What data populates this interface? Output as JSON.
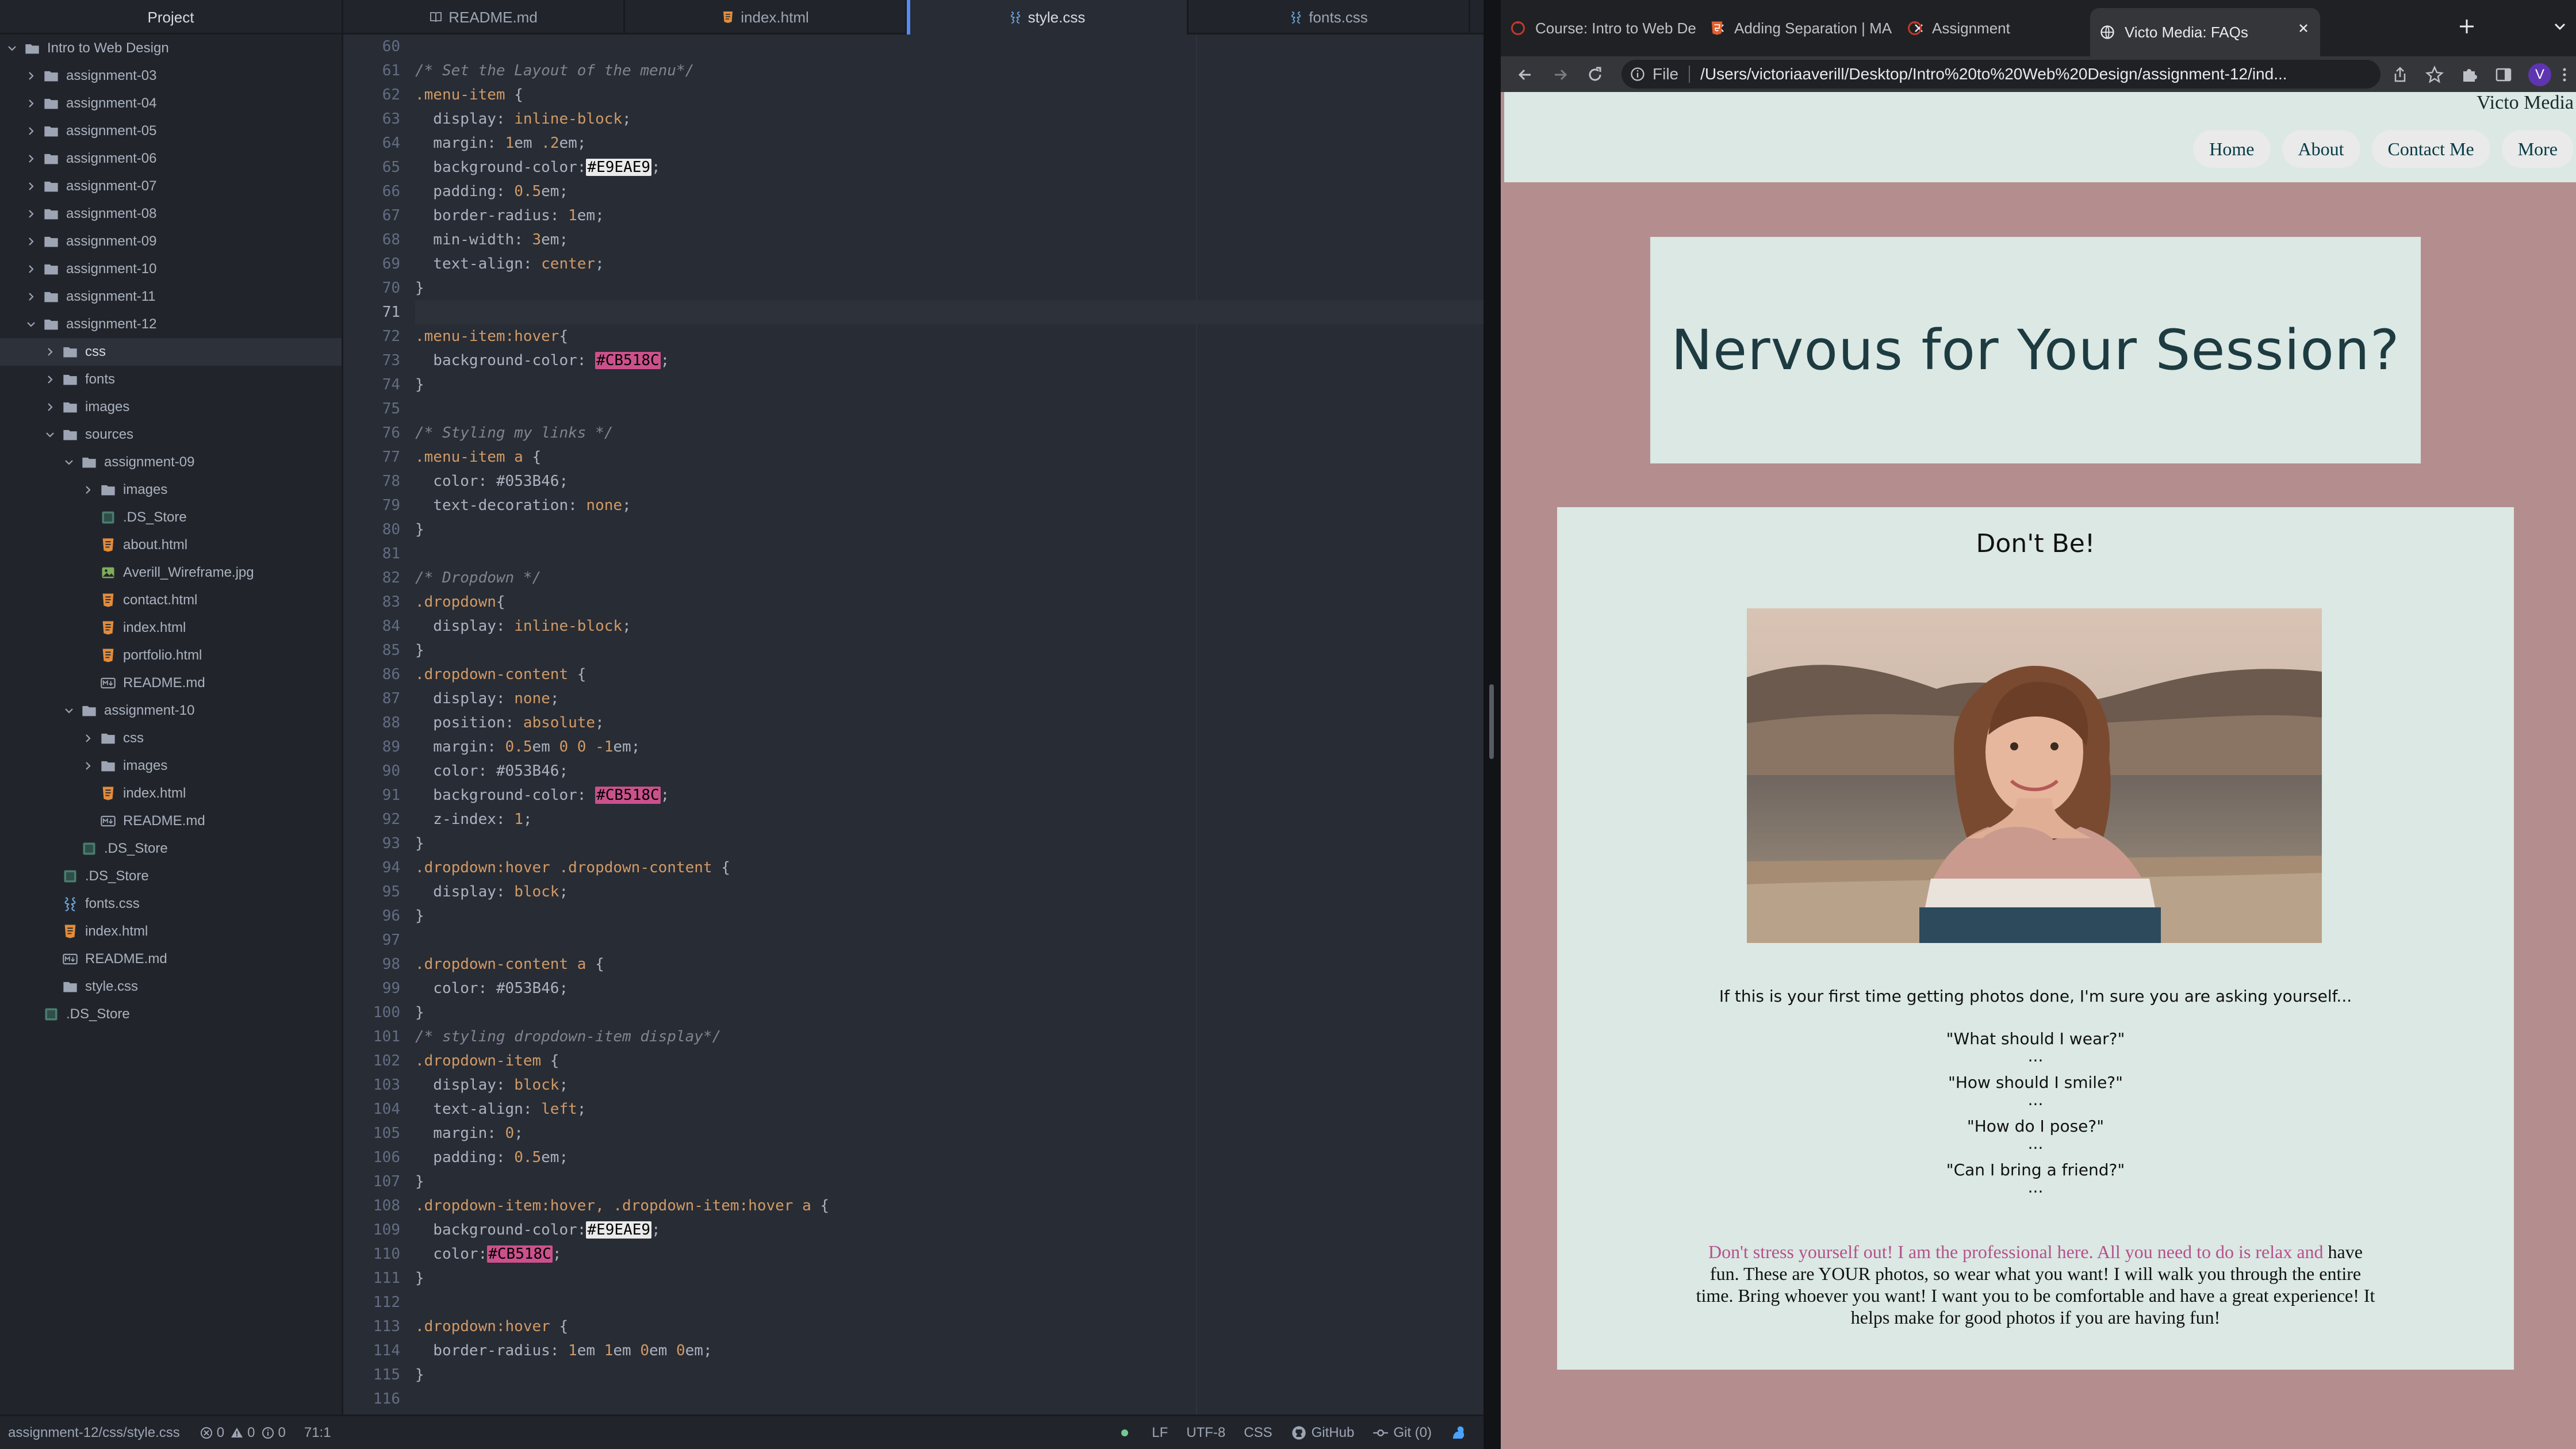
{
  "project": {
    "title": "Project",
    "tree": [
      {
        "label": "Intro to Web Design",
        "type": "root",
        "depth": 0,
        "open": true
      },
      {
        "label": "assignment-03",
        "type": "folder",
        "depth": 1,
        "open": false
      },
      {
        "label": "assignment-04",
        "type": "folder",
        "depth": 1,
        "open": false
      },
      {
        "label": "assignment-05",
        "type": "folder",
        "depth": 1,
        "open": false
      },
      {
        "label": "assignment-06",
        "type": "folder",
        "depth": 1,
        "open": false
      },
      {
        "label": "assignment-07",
        "type": "folder",
        "depth": 1,
        "open": false
      },
      {
        "label": "assignment-08",
        "type": "folder",
        "depth": 1,
        "open": false
      },
      {
        "label": "assignment-09",
        "type": "folder",
        "depth": 1,
        "open": false
      },
      {
        "label": "assignment-10",
        "type": "folder",
        "depth": 1,
        "open": false
      },
      {
        "label": "assignment-11",
        "type": "folder",
        "depth": 1,
        "open": false
      },
      {
        "label": "assignment-12",
        "type": "folder",
        "depth": 1,
        "open": true
      },
      {
        "label": "css",
        "type": "folder",
        "depth": 2,
        "open": false,
        "selected": true
      },
      {
        "label": "fonts",
        "type": "folder",
        "depth": 2,
        "open": false
      },
      {
        "label": "images",
        "type": "folder",
        "depth": 2,
        "open": false
      },
      {
        "label": "sources",
        "type": "folder",
        "depth": 2,
        "open": true
      },
      {
        "label": "assignment-09",
        "type": "folder",
        "depth": 3,
        "open": true
      },
      {
        "label": "images",
        "type": "folder",
        "depth": 4,
        "open": false
      },
      {
        "label": ".DS_Store",
        "type": "ds",
        "depth": 4
      },
      {
        "label": "about.html",
        "type": "html",
        "depth": 4
      },
      {
        "label": "Averill_Wireframe.jpg",
        "type": "image",
        "depth": 4
      },
      {
        "label": "contact.html",
        "type": "html",
        "depth": 4
      },
      {
        "label": "index.html",
        "type": "html",
        "depth": 4
      },
      {
        "label": "portfolio.html",
        "type": "html",
        "depth": 4
      },
      {
        "label": "README.md",
        "type": "md",
        "depth": 4
      },
      {
        "label": "assignment-10",
        "type": "folder",
        "depth": 3,
        "open": true
      },
      {
        "label": "css",
        "type": "folder",
        "depth": 4,
        "open": false
      },
      {
        "label": "images",
        "type": "folder",
        "depth": 4,
        "open": false
      },
      {
        "label": "index.html",
        "type": "html",
        "depth": 4
      },
      {
        "label": "README.md",
        "type": "md",
        "depth": 4
      },
      {
        "label": ".DS_Store",
        "type": "ds",
        "depth": 3
      },
      {
        "label": ".DS_Store",
        "type": "ds",
        "depth": 2
      },
      {
        "label": "fonts.css",
        "type": "css",
        "depth": 2
      },
      {
        "label": "index.html",
        "type": "html",
        "depth": 2
      },
      {
        "label": "README.md",
        "type": "md",
        "depth": 2
      },
      {
        "label": "style.css",
        "type": "cssfolder",
        "depth": 2
      },
      {
        "label": ".DS_Store",
        "type": "ds",
        "depth": 1
      }
    ]
  },
  "editor": {
    "tabs": [
      {
        "label": "README.md",
        "icon": "book-icon",
        "active": false
      },
      {
        "label": "index.html",
        "icon": "html-file-icon",
        "active": false
      },
      {
        "label": "style.css",
        "icon": "css-file-icon",
        "active": true
      },
      {
        "label": "fonts.css",
        "icon": "css-file-icon",
        "active": false
      }
    ],
    "first_line": 60,
    "cursor_line": 71,
    "lines": [
      [],
      [
        [
          "com",
          "/* Set the Layout of the menu*/"
        ]
      ],
      [
        [
          "sel",
          ".menu-item"
        ],
        [
          "plain",
          " {"
        ]
      ],
      [
        [
          "plain",
          "  display: "
        ],
        [
          "val",
          "inline-block"
        ],
        [
          "plain",
          ";"
        ]
      ],
      [
        [
          "plain",
          "  margin: "
        ],
        [
          "num",
          "1"
        ],
        [
          "unit",
          "em "
        ],
        [
          "num",
          ".2"
        ],
        [
          "unit",
          "em"
        ],
        [
          "plain",
          ";"
        ]
      ],
      [
        [
          "plain",
          "  background-color:"
        ],
        [
          "swl",
          "#E9EAE9"
        ],
        [
          "plain",
          ";"
        ]
      ],
      [
        [
          "plain",
          "  padding: "
        ],
        [
          "num",
          "0.5"
        ],
        [
          "unit",
          "em"
        ],
        [
          "plain",
          ";"
        ]
      ],
      [
        [
          "plain",
          "  border-radius: "
        ],
        [
          "num",
          "1"
        ],
        [
          "unit",
          "em"
        ],
        [
          "plain",
          ";"
        ]
      ],
      [
        [
          "plain",
          "  min-width: "
        ],
        [
          "num",
          "3"
        ],
        [
          "unit",
          "em"
        ],
        [
          "plain",
          ";"
        ]
      ],
      [
        [
          "plain",
          "  text-align: "
        ],
        [
          "val",
          "center"
        ],
        [
          "plain",
          ";"
        ]
      ],
      [
        [
          "plain",
          "}"
        ]
      ],
      [],
      [
        [
          "sel",
          ".menu-item:hover"
        ],
        [
          "plain",
          "{"
        ]
      ],
      [
        [
          "plain",
          "  background-color: "
        ],
        [
          "swp",
          "#CB518C"
        ],
        [
          "plain",
          ";"
        ]
      ],
      [
        [
          "plain",
          "}"
        ]
      ],
      [],
      [
        [
          "com",
          "/* Styling my links */"
        ]
      ],
      [
        [
          "sel",
          ".menu-item a"
        ],
        [
          "plain",
          " {"
        ]
      ],
      [
        [
          "plain",
          "  color: "
        ],
        [
          "hex",
          "#053B46"
        ],
        [
          "plain",
          ";"
        ]
      ],
      [
        [
          "plain",
          "  text-decoration: "
        ],
        [
          "val",
          "none"
        ],
        [
          "plain",
          ";"
        ]
      ],
      [
        [
          "plain",
          "}"
        ]
      ],
      [],
      [
        [
          "com",
          "/* Dropdown */"
        ]
      ],
      [
        [
          "sel",
          ".dropdown"
        ],
        [
          "plain",
          "{"
        ]
      ],
      [
        [
          "plain",
          "  display: "
        ],
        [
          "val",
          "inline-block"
        ],
        [
          "plain",
          ";"
        ]
      ],
      [
        [
          "plain",
          "}"
        ]
      ],
      [
        [
          "sel",
          ".dropdown-content"
        ],
        [
          "plain",
          " {"
        ]
      ],
      [
        [
          "plain",
          "  display: "
        ],
        [
          "val",
          "none"
        ],
        [
          "plain",
          ";"
        ]
      ],
      [
        [
          "plain",
          "  position: "
        ],
        [
          "val",
          "absolute"
        ],
        [
          "plain",
          ";"
        ]
      ],
      [
        [
          "plain",
          "  margin: "
        ],
        [
          "num",
          "0.5"
        ],
        [
          "unit",
          "em "
        ],
        [
          "num",
          "0 0 -1"
        ],
        [
          "unit",
          "em"
        ],
        [
          "plain",
          ";"
        ]
      ],
      [
        [
          "plain",
          "  color: "
        ],
        [
          "hex",
          "#053B46"
        ],
        [
          "plain",
          ";"
        ]
      ],
      [
        [
          "plain",
          "  background-color: "
        ],
        [
          "swp",
          "#CB518C"
        ],
        [
          "plain",
          ";"
        ]
      ],
      [
        [
          "plain",
          "  z-index: "
        ],
        [
          "num",
          "1"
        ],
        [
          "plain",
          ";"
        ]
      ],
      [
        [
          "plain",
          "}"
        ]
      ],
      [
        [
          "sel",
          ".dropdown:hover .dropdown-content"
        ],
        [
          "plain",
          " {"
        ]
      ],
      [
        [
          "plain",
          "  display: "
        ],
        [
          "val",
          "block"
        ],
        [
          "plain",
          ";"
        ]
      ],
      [
        [
          "plain",
          "}"
        ]
      ],
      [],
      [
        [
          "sel",
          ".dropdown-content a"
        ],
        [
          "plain",
          " {"
        ]
      ],
      [
        [
          "plain",
          "  color: "
        ],
        [
          "hex",
          "#053B46"
        ],
        [
          "plain",
          ";"
        ]
      ],
      [
        [
          "plain",
          "}"
        ]
      ],
      [
        [
          "com",
          "/* styling dropdown-item display*/"
        ]
      ],
      [
        [
          "sel",
          ".dropdown-item"
        ],
        [
          "plain",
          " {"
        ]
      ],
      [
        [
          "plain",
          "  display: "
        ],
        [
          "val",
          "block"
        ],
        [
          "plain",
          ";"
        ]
      ],
      [
        [
          "plain",
          "  text-align: "
        ],
        [
          "val",
          "left"
        ],
        [
          "plain",
          ";"
        ]
      ],
      [
        [
          "plain",
          "  margin: "
        ],
        [
          "num",
          "0"
        ],
        [
          "plain",
          ";"
        ]
      ],
      [
        [
          "plain",
          "  padding: "
        ],
        [
          "num",
          "0.5"
        ],
        [
          "unit",
          "em"
        ],
        [
          "plain",
          ";"
        ]
      ],
      [
        [
          "plain",
          "}"
        ]
      ],
      [
        [
          "sel",
          ".dropdown-item:hover, .dropdown-item:hover a"
        ],
        [
          "plain",
          " {"
        ]
      ],
      [
        [
          "plain",
          "  background-color:"
        ],
        [
          "swl",
          "#E9EAE9"
        ],
        [
          "plain",
          ";"
        ]
      ],
      [
        [
          "plain",
          "  color:"
        ],
        [
          "swp",
          "#CB518C"
        ],
        [
          "plain",
          ";"
        ]
      ],
      [
        [
          "plain",
          "}"
        ]
      ],
      [],
      [
        [
          "sel",
          ".dropdown:hover"
        ],
        [
          "plain",
          " {"
        ]
      ],
      [
        [
          "plain",
          "  border-radius: "
        ],
        [
          "num",
          "1"
        ],
        [
          "unit",
          "em "
        ],
        [
          "num",
          "1"
        ],
        [
          "unit",
          "em "
        ],
        [
          "num",
          "0"
        ],
        [
          "unit",
          "em "
        ],
        [
          "num",
          "0"
        ],
        [
          "unit",
          "em"
        ],
        [
          "plain",
          ";"
        ]
      ],
      [
        [
          "plain",
          "}"
        ]
      ],
      []
    ]
  },
  "status": {
    "path": "assignment-12/css/style.css",
    "errors": "0",
    "warnings": "0",
    "infos": "0",
    "cursor": "71:1",
    "line_ending": "LF",
    "encoding": "UTF-8",
    "grammar": "CSS",
    "github": "GitHub",
    "git": "Git (0)"
  },
  "browser": {
    "tabs": [
      {
        "title": "Course: Intro to Web De",
        "icon": "canvas-icon",
        "active": false
      },
      {
        "title": "Adding Separation | MA",
        "icon": "html5-icon",
        "active": false
      },
      {
        "title": "Assignment",
        "icon": "canvas-icon",
        "active": false
      },
      {
        "title": "Victo Media: FAQs",
        "icon": "globe-icon",
        "active": true
      }
    ],
    "omnibox": {
      "scheme_label": "File",
      "url": "/Users/victoriaaverill/Desktop/Intro%20to%20Web%20Design/assignment-12/ind..."
    },
    "profile_initial": "V"
  },
  "site": {
    "brand": "Victo Media",
    "menu": [
      "Home",
      "About",
      "Contact Me",
      "More"
    ],
    "hero_title": "Nervous for Your Session?",
    "card_title": "Don't Be!",
    "intro": "If this is your first time getting photos done, I'm sure you are asking yourself...",
    "questions": [
      "\"What should I wear?\"",
      "\"How should I smile?\"",
      "\"How do I pose?\"",
      "\"Can I bring a friend?\""
    ],
    "dots": "...",
    "outro_pink": "Don't stress yourself out! I am the professional here. All you need to do is relax and",
    "outro_rest": "have fun. These are YOUR photos, so wear what you want! I will walk you through the entire time. Bring whoever you want! I want you to be comfortable and have a great experience! It helps make for good photos if you are having fun!"
  },
  "colors": {
    "editor_bg": "#282c34",
    "panel_bg": "#21252b",
    "swatch_light": "#E9EAE9",
    "swatch_pink": "#CB518C",
    "site_bg": "#b48e8f",
    "site_card": "#dbe8e4",
    "link": "#053B46"
  }
}
